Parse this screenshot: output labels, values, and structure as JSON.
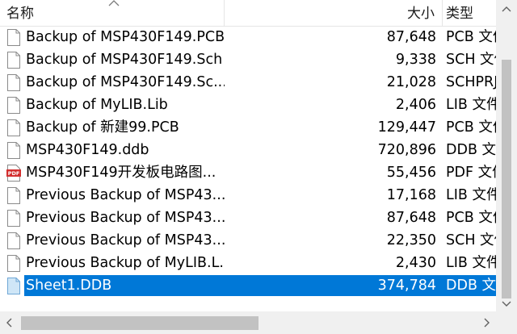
{
  "columns": {
    "name": "名称",
    "size": "大小",
    "type": "类型"
  },
  "files": [
    {
      "name": "Backup of MSP430F149.PCB",
      "size": "87,648",
      "type": "PCB 文件",
      "icon": "document-icon",
      "selected": false
    },
    {
      "name": "Backup of MSP430F149.Sch",
      "size": "9,338",
      "type": "SCH 文件",
      "icon": "document-icon",
      "selected": false
    },
    {
      "name": "Backup of MSP430F149.Sc...",
      "size": "21,028",
      "type": "SCHPRJ",
      "icon": "document-icon",
      "selected": false
    },
    {
      "name": "Backup of MyLIB.Lib",
      "size": "2,406",
      "type": "LIB 文件",
      "icon": "document-icon",
      "selected": false
    },
    {
      "name": "Backup of 新建99.PCB",
      "size": "129,447",
      "type": "PCB 文件",
      "icon": "document-icon",
      "selected": false
    },
    {
      "name": "MSP430F149.ddb",
      "size": "720,896",
      "type": "DDB 文件",
      "icon": "document-icon",
      "selected": false
    },
    {
      "name": "MSP430F149开发板电路图...",
      "size": "55,456",
      "type": "PDF 文件",
      "icon": "pdf-icon",
      "selected": false
    },
    {
      "name": "Previous Backup of MSP43...",
      "size": "17,168",
      "type": "LIB 文件",
      "icon": "document-icon",
      "selected": false
    },
    {
      "name": "Previous Backup of MSP43...",
      "size": "87,648",
      "type": "PCB 文件",
      "icon": "document-icon",
      "selected": false
    },
    {
      "name": "Previous Backup of MSP43...",
      "size": "22,350",
      "type": "SCH 文件",
      "icon": "document-icon",
      "selected": false
    },
    {
      "name": "Previous Backup of MyLIB.L...",
      "size": "2,430",
      "type": "LIB 文件",
      "icon": "document-icon",
      "selected": false
    },
    {
      "name": "Sheet1.DDB",
      "size": "374,784",
      "type": "DDB 文件",
      "icon": "document-blue-icon",
      "selected": true
    }
  ],
  "pdf_badge": "PDF",
  "colors": {
    "selection": "#0078d7",
    "scrollbar_track": "#f0f0f0",
    "scrollbar_thumb": "#c2c2c2"
  }
}
